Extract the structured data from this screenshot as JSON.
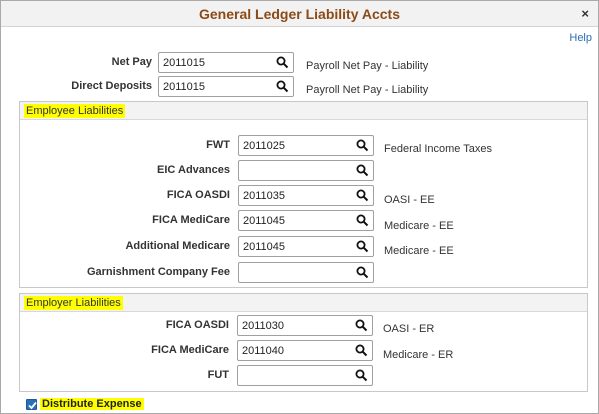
{
  "window": {
    "title": "General Ledger Liability Accts",
    "close_glyph": "×",
    "help_label": "Help"
  },
  "top_fields": [
    {
      "label": "Net Pay",
      "value": "2011015",
      "desc": "Payroll Net Pay - Liability"
    },
    {
      "label": "Direct Deposits",
      "value": "2011015",
      "desc": "Payroll Net Pay - Liability"
    }
  ],
  "employee_liabilities": {
    "title": "Employee Liabilities",
    "fields": [
      {
        "label": "FWT",
        "value": "2011025",
        "desc": "Federal Income Taxes"
      },
      {
        "label": "EIC Advances",
        "value": "",
        "desc": ""
      },
      {
        "label": "FICA OASDI",
        "value": "2011035",
        "desc": "OASI - EE"
      },
      {
        "label": "FICA MediCare",
        "value": "2011045",
        "desc": "Medicare - EE"
      },
      {
        "label": "Additional Medicare",
        "value": "2011045",
        "desc": "Medicare - EE"
      },
      {
        "label": "Garnishment Company Fee",
        "value": "",
        "desc": ""
      }
    ]
  },
  "employer_liabilities": {
    "title": "Employer Liabilities",
    "fields": [
      {
        "label": "FICA OASDI",
        "value": "2011030",
        "desc": "OASI - ER"
      },
      {
        "label": "FICA MediCare",
        "value": "2011040",
        "desc": "Medicare - ER"
      },
      {
        "label": "FUT",
        "value": "",
        "desc": ""
      }
    ]
  },
  "distribute_expense": {
    "label": "Distribute Expense",
    "checked": true
  },
  "icons": {
    "lookup": "magnifier-icon",
    "close": "close-icon",
    "check": "checkmark-icon"
  },
  "colors": {
    "title": "#8b4a16",
    "link": "#2b6fb6",
    "highlight": "#ffff00"
  }
}
